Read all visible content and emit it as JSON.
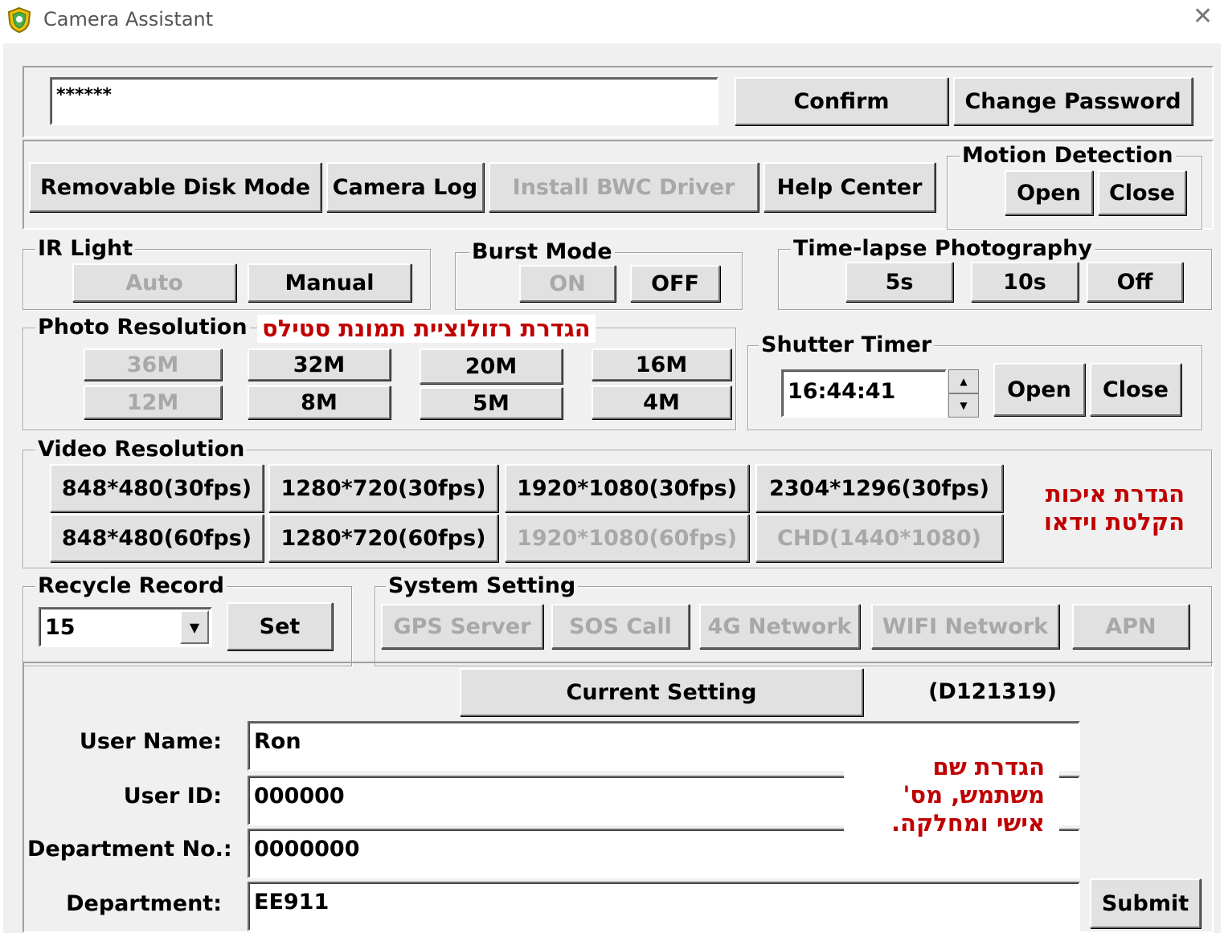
{
  "window": {
    "title": "Camera Assistant",
    "close_glyph": "✕",
    "icon": "shield-icon"
  },
  "password": {
    "value": "******",
    "confirm_label": "Confirm",
    "change_label": "Change Password"
  },
  "toolbar": {
    "removable_disk": "Removable Disk Mode",
    "camera_log": "Camera Log",
    "install_driver": "Install BWC Driver",
    "help_center": "Help Center"
  },
  "motion_detection": {
    "legend": "Motion Detection",
    "open": "Open",
    "close": "Close"
  },
  "ir_light": {
    "legend": "IR Light",
    "auto": "Auto",
    "manual": "Manual"
  },
  "burst_mode": {
    "legend": "Burst Mode",
    "on": "ON",
    "off": "OFF"
  },
  "time_lapse": {
    "legend": "Time-lapse Photography",
    "b1": "5s",
    "b2": "10s",
    "b3": "Off"
  },
  "photo_resolution": {
    "legend": "Photo Resolution",
    "annotation": "הגדרת רזולוציית תמונת סטילס",
    "row1": [
      "36M",
      "32M",
      "20M",
      "16M"
    ],
    "row2": [
      "12M",
      "8M",
      "5M",
      "4M"
    ]
  },
  "shutter_timer": {
    "legend": "Shutter Timer",
    "time": "16:44:41",
    "open": "Open",
    "close": "Close"
  },
  "video_resolution": {
    "legend": "Video Resolution",
    "annotation_line1": "הגדרת איכות",
    "annotation_line2": "הקלטת וידאו",
    "row1": [
      "848*480(30fps)",
      "1280*720(30fps)",
      "1920*1080(30fps)",
      "2304*1296(30fps)"
    ],
    "row2": [
      "848*480(60fps)",
      "1280*720(60fps)",
      "1920*1080(60fps)",
      "CHD(1440*1080)"
    ]
  },
  "recycle_record": {
    "legend": "Recycle Record",
    "value": "15",
    "set": "Set"
  },
  "system_setting": {
    "legend": "System Setting",
    "gps": "GPS Server",
    "sos": "SOS Call",
    "g4": "4G Network",
    "wifi": "WIFI Network",
    "apn": "APN"
  },
  "user": {
    "current_setting": "Current Setting",
    "device_id": "(D121319)",
    "name_label": "User Name:",
    "name_value": "Ron",
    "id_label": "User ID:",
    "id_value": "000000",
    "dept_no_label": "Department No.:",
    "dept_no_value": "0000000",
    "dept_label": "Department:",
    "dept_value": "EE911",
    "submit": "Submit",
    "annotation_line1": "הגדרת שם",
    "annotation_line2": "משתמש, מס'",
    "annotation_line3": "אישי ומחלקה."
  },
  "colors": {
    "annotation": "#c00000",
    "face": "#f0f0f0",
    "button": "#e1e1e1",
    "disabled_text": "#a8a8a8"
  }
}
